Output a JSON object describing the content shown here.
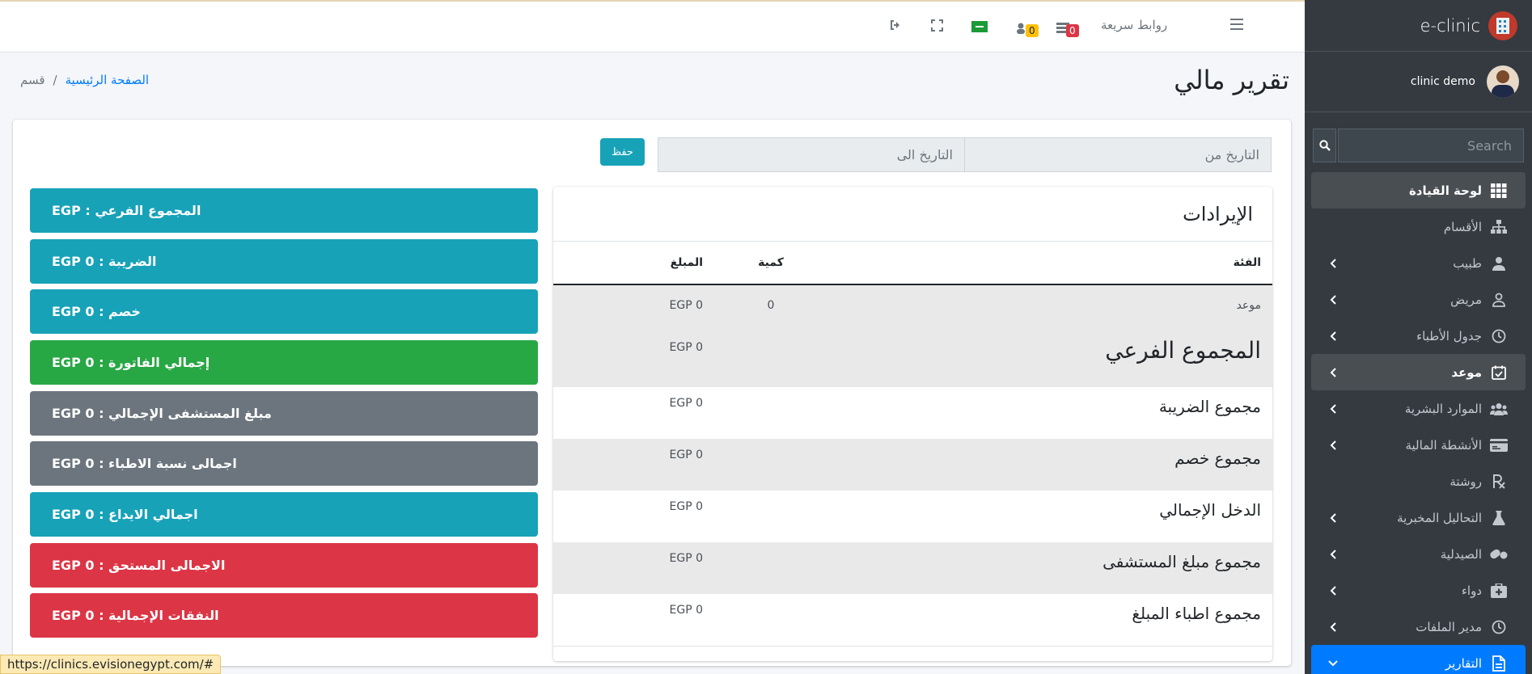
{
  "sidebar": {
    "brand": "e-clinic",
    "user": "clinic demo",
    "search_placeholder": "Search",
    "items": [
      {
        "label": "لوحة القيادة",
        "icon": "grid-icon",
        "chevron": false
      },
      {
        "label": "الأقسام",
        "icon": "sitemap-icon",
        "chevron": false
      },
      {
        "label": "طبيب",
        "icon": "doctor-icon",
        "chevron": true
      },
      {
        "label": "مريض",
        "icon": "user-icon",
        "chevron": true
      },
      {
        "label": "جدول الأطباء",
        "icon": "clock-icon",
        "chevron": true
      },
      {
        "label": "موعد",
        "icon": "calendar-check-icon",
        "chevron": true
      },
      {
        "label": "الموارد البشرية",
        "icon": "users-icon",
        "chevron": true
      },
      {
        "label": "الأنشطة المالية",
        "icon": "credit-card-icon",
        "chevron": true
      },
      {
        "label": "روشتة",
        "icon": "prescription-icon",
        "chevron": false
      },
      {
        "label": "التحاليل المخبرية",
        "icon": "flask-icon",
        "chevron": true
      },
      {
        "label": "الصيدلية",
        "icon": "pills-icon",
        "chevron": true
      },
      {
        "label": "دواء",
        "icon": "medkit-icon",
        "chevron": true
      },
      {
        "label": "مدير الملفات",
        "icon": "clock-icon",
        "chevron": true
      },
      {
        "label": "التقارير",
        "icon": "file-report-icon",
        "chevron": true
      }
    ]
  },
  "topbar": {
    "quick_links": "روابط سريعة",
    "badge_notifications": "0",
    "badge_users": "0"
  },
  "header": {
    "title": "تقرير مالي",
    "breadcrumb_home": "الصفحة الرئيسية",
    "breadcrumb_sep": "/",
    "breadcrumb_current": "قسم"
  },
  "filters": {
    "date_from_placeholder": "التاريخ من",
    "date_to_placeholder": "التاريخ الى",
    "save_label": "حفظ"
  },
  "summaries": [
    {
      "label": "المجموع الفرعي : EGP",
      "color": "#17a2b8"
    },
    {
      "label": "الضريبة : EGP 0",
      "color": "#17a2b8"
    },
    {
      "label": "خصم : EGP 0",
      "color": "#17a2b8"
    },
    {
      "label": "إجمالي الفاتورة : EGP 0",
      "color": "#28a745"
    },
    {
      "label": "مبلغ المستشفى الإجمالي : EGP 0",
      "color": "#6c757d"
    },
    {
      "label": "اجمالى نسبة الاطباء : EGP 0",
      "color": "#6c757d"
    },
    {
      "label": "اجمالي الايداع : EGP 0",
      "color": "#17a2b8"
    },
    {
      "label": "الاجمالى المستحق : EGP 0",
      "color": "#dc3545"
    },
    {
      "label": "النفقات الإجمالية : EGP 0",
      "color": "#dc3545"
    }
  ],
  "revenue": {
    "title": "الإيرادات",
    "columns": {
      "category": "الفئة",
      "qty": "كمية",
      "amount": "المبلغ"
    },
    "rows": [
      {
        "category": "موعد",
        "qty": "0",
        "amount": "EGP 0"
      },
      {
        "category": "المجموع الفرعي",
        "qty": "",
        "amount": "EGP 0"
      },
      {
        "category": "مجموع الضريبة",
        "qty": "",
        "amount": "EGP 0"
      },
      {
        "category": "مجموع خصم",
        "qty": "",
        "amount": "EGP 0"
      },
      {
        "category": "الدخل الإجمالي",
        "qty": "",
        "amount": "EGP 0"
      },
      {
        "category": "مجموع مبلغ المستشفى",
        "qty": "",
        "amount": "EGP 0"
      },
      {
        "category": "مجموع اطباء المبلغ",
        "qty": "",
        "amount": "EGP 0"
      }
    ]
  },
  "status_url": "https://clinics.evisionegypt.com/#"
}
